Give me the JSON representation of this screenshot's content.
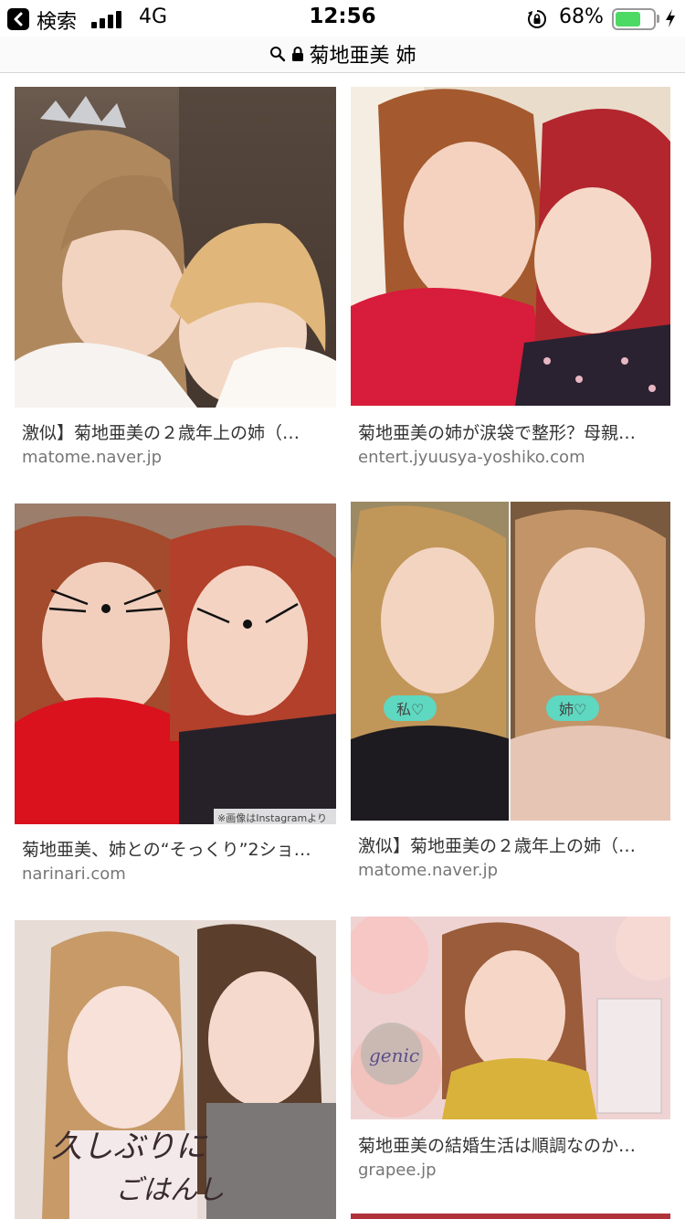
{
  "status_bar": {
    "back_label": "検索",
    "network": "4G",
    "time": "12:56",
    "battery_percent": "68%",
    "battery_level": 0.68,
    "colors": {
      "battery": "#4cd964"
    }
  },
  "address_bar": {
    "query": "菊地亜美 姉",
    "icons": [
      "search-icon",
      "lock-icon"
    ]
  },
  "results": [
    {
      "title": "激似】菊地亜美の２歳年上の姉（…",
      "domain": "matome.naver.jp"
    },
    {
      "title": "菊地亜美の姉が涙袋で整形？母親…",
      "domain": "entert.jyuusya-yoshiko.com"
    },
    {
      "title": "菊地亜美、姉との“そっくり”2ショ…",
      "domain": "narinari.com",
      "image_caption": "※画像はInstagramより"
    },
    {
      "title": "激似】菊地亜美の２歳年上の姉（…",
      "domain": "matome.naver.jp",
      "stickers": [
        "私♡",
        "姉♡"
      ]
    },
    {
      "title": "",
      "domain": "",
      "handwriting": [
        "久しぶりに",
        "ごはんし"
      ]
    },
    {
      "title": "菊地亜美の結婚生活は順調なのか…",
      "domain": "grapee.jp",
      "logo_text": "genic"
    }
  ]
}
